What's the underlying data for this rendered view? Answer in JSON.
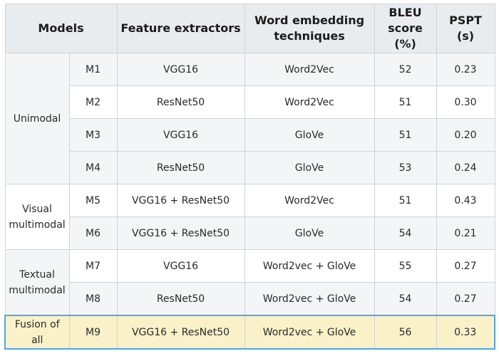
{
  "headers": {
    "models": "Models",
    "feature": "Feature extractors",
    "word_line1": "Word embedding",
    "word_line2": "techniques",
    "bleu_line1": "BLEU",
    "bleu_line2": "score (%)",
    "pspt": "PSPT (s)"
  },
  "groups": {
    "unimodal": "Unimodal",
    "visual_line1": "Visual",
    "visual_line2": "multimodal",
    "textual_line1": "Textual",
    "textual_line2": "multimodal",
    "fusion": "Fusion of all"
  },
  "rows": [
    {
      "model": "M1",
      "feature": "VGG16",
      "embedding": "Word2Vec",
      "bleu": "52",
      "pspt": "0.23"
    },
    {
      "model": "M2",
      "feature": "ResNet50",
      "embedding": "Word2Vec",
      "bleu": "51",
      "pspt": "0.30"
    },
    {
      "model": "M3",
      "feature": "VGG16",
      "embedding": "GloVe",
      "bleu": "51",
      "pspt": "0.20"
    },
    {
      "model": "M4",
      "feature": "ResNet50",
      "embedding": "GloVe",
      "bleu": "53",
      "pspt": "0.24"
    },
    {
      "model": "M5",
      "feature": "VGG16 + ResNet50",
      "embedding": "Word2Vec",
      "bleu": "51",
      "pspt": "0.43"
    },
    {
      "model": "M6",
      "feature": "VGG16 + ResNet50",
      "embedding": "GloVe",
      "bleu": "54",
      "pspt": "0.21"
    },
    {
      "model": "M7",
      "feature": "VGG16",
      "embedding": "Word2vec + GloVe",
      "bleu": "55",
      "pspt": "0.27"
    },
    {
      "model": "M8",
      "feature": "ResNet50",
      "embedding": "Word2vec + GloVe",
      "bleu": "54",
      "pspt": "0.27"
    },
    {
      "model": "M9",
      "feature": "VGG16 + ResNet50",
      "embedding": "Word2vec + GloVe",
      "bleu": "56",
      "pspt": "0.33"
    }
  ],
  "colors": {
    "header_bg": "#e9ecef",
    "shaded_row": "#f4f5f7",
    "highlight_bg": "#fbf1c9",
    "highlight_border": "#4ea6ea",
    "grid": "#cfd3d8"
  }
}
